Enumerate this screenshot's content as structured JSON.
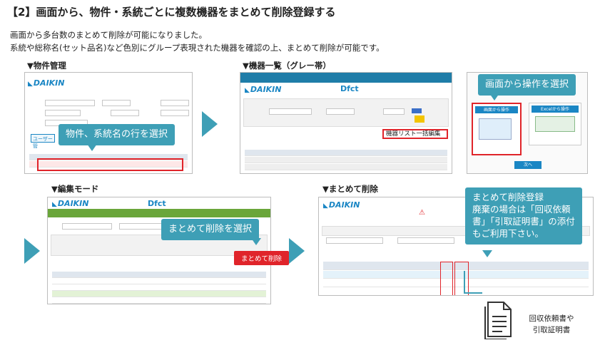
{
  "title": "【2】画面から、物件・系統ごとに複数機器をまとめて削除登録する",
  "intro": {
    "line1": "画面から多台数のまとめて削除が可能になりました。",
    "line2": "系統や総称名(セット品名)など色別にグループ表現された機器を確認の上、まとめて削除が可能です。"
  },
  "panels": {
    "property_mgmt": {
      "label": "▼物件管理",
      "brand": "DAIKIN",
      "callout": "物件、系統名の行を選択",
      "tab_user": "ユーザー管"
    },
    "device_list": {
      "label": "▼機器一覧（グレー帯）",
      "brand": "DAIKIN",
      "app": "Dfct",
      "bulk_edit": "機器リスト一括編集"
    },
    "screen_op": {
      "callout": "画面から操作を選択",
      "card_left": "画面から操作",
      "card_right": "Excelから操作",
      "next_button": "次へ"
    },
    "edit_mode": {
      "label": "▼編集モード",
      "brand": "DAIKIN",
      "app": "Dfct",
      "callout": "まとめて削除を選択",
      "delete_button": "まとめて削除"
    },
    "bulk_delete": {
      "label": "▼まとめて削除",
      "brand": "DAIKIN",
      "callout": "まとめて削除登録\n廃棄の場合は「回収依頼書」「引取証明書」の添付もご利用下さい。",
      "doc_label_1": "回収依頼書や",
      "doc_label_2": "引取証明書"
    }
  },
  "colors": {
    "callout": "#3e9fb6",
    "accent_red": "#e0242a",
    "daikin_blue": "#1a86c4",
    "edit_green": "#6aa63a"
  }
}
